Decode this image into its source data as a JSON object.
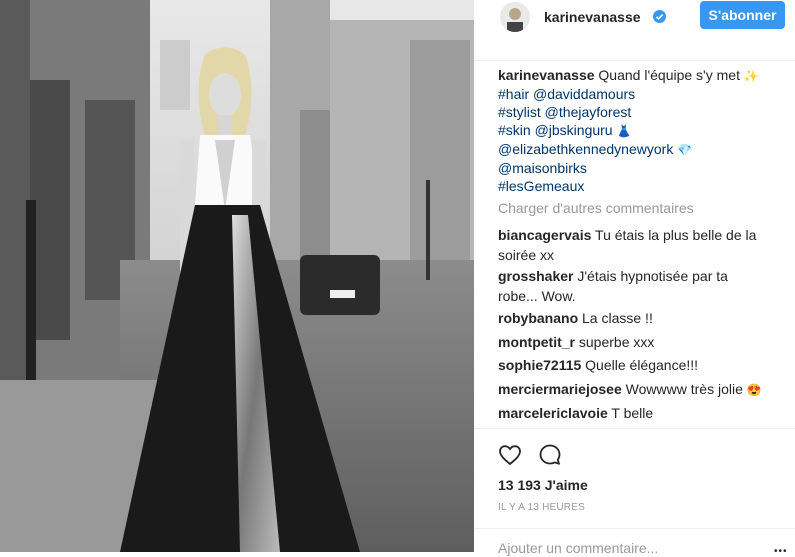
{
  "post": {
    "username": "karinevanasse",
    "follow_label": "S'abonner",
    "caption_text": "Quand l'équipe s'y met",
    "caption_lines": [
      "#hair @daviddamours",
      "#stylist @thejayforest",
      "#skin @jbskinguru",
      "@elizabethkennedynewyork",
      "@maisonbirks",
      "#lesGemeaux"
    ],
    "caption_emojis": {
      "sparkles": "✨",
      "dress": "👗",
      "gem": "💎"
    },
    "load_more": "Charger d'autres commentaires",
    "comments": [
      {
        "user": "biancagervais",
        "text": "Tu étais la plus belle de la",
        "text2": "soirée xx"
      },
      {
        "user": "grosshaker",
        "text": "J'étais hypnotisée par ta",
        "text2": "robe... Wow."
      },
      {
        "user": "robybanano",
        "text": "La classe !!"
      },
      {
        "user": "montpetit_r",
        "text": "superbe xxx"
      },
      {
        "user": "sophie72115",
        "text": "Quelle élégance!!!"
      },
      {
        "user": "merciermariejosee",
        "text": "Wowwww très jolie",
        "emoji": "😍"
      },
      {
        "user": "marcelericlavoie",
        "text": "T belle"
      }
    ],
    "likes": "13 193 J'aime",
    "time": "IL Y A 13 HEURES",
    "add_comment_placeholder": "Ajouter un commentaire...",
    "more_label": "•••"
  },
  "colors": {
    "accent": "#3897f0",
    "link": "#003569",
    "muted": "#999999",
    "text": "#262626"
  },
  "icons": [
    "verified-icon",
    "heart-icon",
    "comment-icon",
    "more-icon"
  ]
}
